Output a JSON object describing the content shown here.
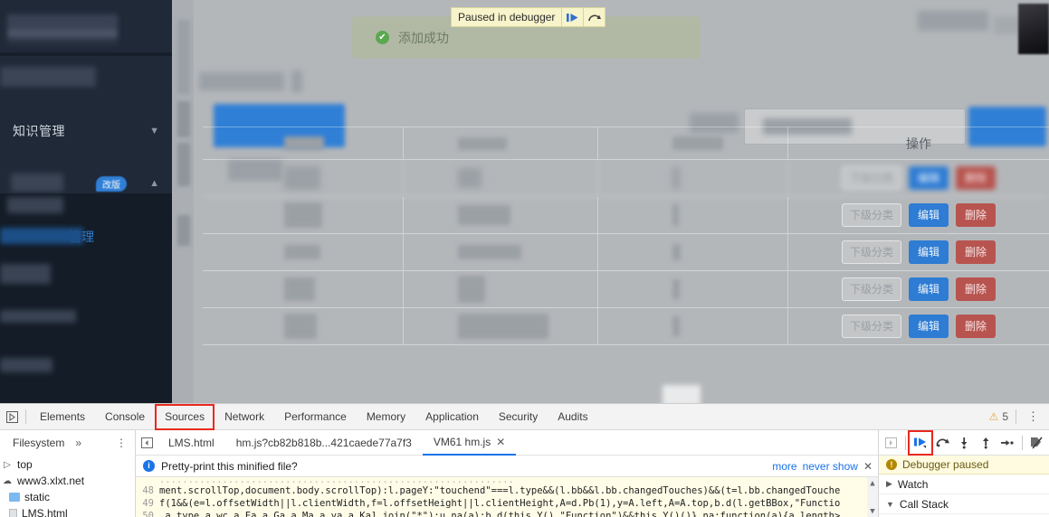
{
  "page": {
    "sidebar": {
      "items": [
        {
          "label": "知识管理",
          "icon": "chevron-down-icon",
          "blurred": false
        },
        {
          "label": "",
          "badge": "改版",
          "icon": "chevron-up-icon",
          "blurred": true
        },
        {
          "label": "管理",
          "active": true,
          "blurred": false
        }
      ]
    },
    "toast": {
      "icon": "check-circle-icon",
      "message": "添加成功"
    },
    "paused_bubble": {
      "label": "Paused in debugger",
      "resume_icon": "resume-script-icon",
      "step_over_icon": "step-over-icon"
    },
    "table": {
      "headers": [
        "",
        "",
        "",
        "操作"
      ],
      "action_labels": {
        "sub_category": "下级分类",
        "edit": "编辑",
        "delete": "删除"
      },
      "rows": [
        {
          "actions": [
            "下级分类",
            "编辑",
            "删除"
          ],
          "blurred": true
        },
        {
          "actions": [
            "下级分类",
            "编辑",
            "删除"
          ],
          "blurred": false
        },
        {
          "actions": [
            "下级分类",
            "编辑",
            "删除"
          ],
          "blurred": false
        },
        {
          "actions": [
            "下级分类",
            "编辑",
            "删除"
          ],
          "blurred": false
        },
        {
          "actions": [
            "下级分类",
            "编辑",
            "删除"
          ],
          "blurred": false
        }
      ]
    },
    "colors": {
      "primary_blue": "#2e7cd3",
      "danger_red": "#b8544f",
      "sidebar_bg": "#1f2937",
      "toast_bg": "#b0baa0"
    }
  },
  "devtools": {
    "inspect_icon": "inspect-element-icon",
    "tabs": [
      {
        "label": "Elements",
        "selected": false
      },
      {
        "label": "Console",
        "selected": false
      },
      {
        "label": "Sources",
        "selected": true
      },
      {
        "label": "Network",
        "selected": false
      },
      {
        "label": "Performance",
        "selected": false
      },
      {
        "label": "Memory",
        "selected": false
      },
      {
        "label": "Application",
        "selected": false
      },
      {
        "label": "Security",
        "selected": false
      },
      {
        "label": "Audits",
        "selected": false
      }
    ],
    "warnings": {
      "icon": "warning-triangle-icon",
      "count": "5"
    },
    "menu_icon": "kebab-menu-icon",
    "navigator": {
      "header": "Filesystem",
      "more_icon": "chevron-double-right-icon",
      "kebab_icon": "kebab-menu-icon",
      "tree": [
        {
          "label": "top",
          "icon": "expand-icon",
          "indent": 0
        },
        {
          "label": "www3.xlxt.net",
          "icon": "cloud-icon",
          "indent": 0
        },
        {
          "label": "static",
          "icon": "folder-icon",
          "indent": 1
        },
        {
          "label": "LMS.html",
          "icon": "file-icon",
          "indent": 1
        }
      ]
    },
    "file_tabs": {
      "panel_toggle_icon": "show-navigator-icon",
      "tabs": [
        {
          "label": "LMS.html",
          "active": false,
          "closable": false
        },
        {
          "label": "hm.js?cb82b818b...421caede77a7f3",
          "active": false,
          "closable": false
        },
        {
          "label": "VM61 hm.js",
          "active": true,
          "closable": true,
          "close_icon": "close-icon"
        }
      ]
    },
    "debugger_toolbar": {
      "collapse_icon": "show-debugger-sidebar-icon",
      "buttons": [
        {
          "name": "resume-script-execution",
          "icon": "resume-icon",
          "highlighted": true
        },
        {
          "name": "step-over-next-function-call",
          "icon": "step-over-icon",
          "highlighted": false
        },
        {
          "name": "step-into-next-function-call",
          "icon": "step-into-icon",
          "highlighted": false
        },
        {
          "name": "step-out-of-current-function",
          "icon": "step-out-icon",
          "highlighted": false
        },
        {
          "name": "step",
          "icon": "step-icon",
          "highlighted": false
        },
        {
          "name": "deactivate-breakpoints",
          "icon": "deactivate-breakpoints-icon",
          "highlighted": false
        }
      ]
    },
    "pretty_print": {
      "icon": "info-icon",
      "message": "Pretty-print this minified file?",
      "more_label": "more",
      "never_show_label": "never show",
      "close_icon": "close-icon"
    },
    "code": {
      "lines": [
        {
          "number": "48",
          "text": "ment.scrollTop,document.body.scrollTop):l.pageY:\"touchend\"===l.type&&(l.bb&&l.bb.changedTouches)&&(t=l.bb.changedTouche"
        },
        {
          "number": "49",
          "text": "f(1&&(e=l.offsetWidth||l.clientWidth,f=l.offsetHeight||l.clientHeight,A=d.Pb(1),y=A.left,A=A.top,b.d(l.getBBox,\"Functio"
        },
        {
          "number": "50",
          "text": ",a.type,a.wc,a.Ea,a.Ga,a.Ma,a.ya,a.Ka].join(\"*\");u.na(a);b.d(this.Y(),\"Function\")&&this.Y()()},na:function(a){a.length>"
        }
      ],
      "scroll_up_icon": "scroll-up-icon",
      "scroll_down_icon": "scroll-down-icon"
    },
    "sidebar_panes": {
      "paused_banner": {
        "icon": "warning-circle-icon",
        "text": "Debugger paused"
      },
      "sections": [
        {
          "label": "Watch",
          "expanded": false,
          "icon": "triangle-right-icon"
        },
        {
          "label": "Call Stack",
          "expanded": true,
          "icon": "triangle-down-icon"
        }
      ]
    }
  }
}
